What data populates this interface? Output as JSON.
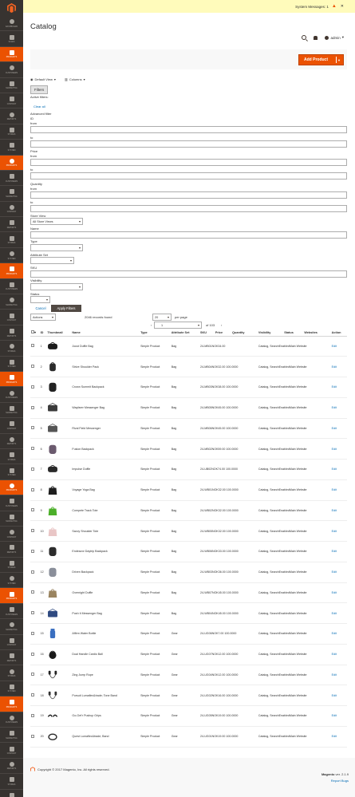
{
  "sidebar": {
    "groups": [
      [
        {
          "label": "Dashboard",
          "icon": "dashboard-icon"
        },
        {
          "label": "Sales",
          "icon": "dollar-icon"
        },
        {
          "label": "Products",
          "icon": "cube-icon",
          "active": true
        },
        {
          "label": "Customers",
          "icon": "user-icon"
        },
        {
          "label": "Marketing",
          "icon": "megaphone-icon"
        },
        {
          "label": "Content",
          "icon": "layout-icon"
        },
        {
          "label": "Reports",
          "icon": "bar-chart-icon"
        },
        {
          "label": "Stores",
          "icon": "store-icon"
        },
        {
          "label": "System",
          "icon": "gear-icon"
        },
        {
          "label": "Products",
          "icon": "cube-icon",
          "active": true
        }
      ],
      [
        {
          "label": "Customers",
          "icon": "user-icon"
        },
        {
          "label": "Marketing",
          "icon": "megaphone-icon"
        },
        {
          "label": "Content",
          "icon": "layout-icon"
        },
        {
          "label": "Reports",
          "icon": "bar-chart-icon"
        },
        {
          "label": "Stores",
          "icon": "store-icon"
        },
        {
          "label": "System",
          "icon": "gear-icon"
        },
        {
          "label": "Products",
          "icon": "cube-icon",
          "active": true
        }
      ]
    ],
    "items": [
      {
        "label": "Dashboard",
        "icon": "dashboard-icon"
      },
      {
        "label": "Sales",
        "icon": "dollar-icon"
      },
      {
        "label": "Products",
        "icon": "cube-icon",
        "active": true
      },
      {
        "label": "Customers",
        "icon": "user-icon"
      },
      {
        "label": "Marketing",
        "icon": "megaphone-icon"
      },
      {
        "label": "Content",
        "icon": "layout-icon"
      },
      {
        "label": "Reports",
        "icon": "bar-chart-icon"
      },
      {
        "label": "Stores",
        "icon": "store-icon"
      },
      {
        "label": "System",
        "icon": "gear-icon"
      },
      {
        "label": "Products",
        "icon": "cube-icon",
        "active": true
      },
      {
        "label": "Customers",
        "icon": "user-icon"
      },
      {
        "label": "Marketing",
        "icon": "megaphone-icon"
      },
      {
        "label": "Content",
        "icon": "layout-icon"
      },
      {
        "label": "Reports",
        "icon": "bar-chart-icon"
      },
      {
        "label": "Stores",
        "icon": "store-icon"
      },
      {
        "label": "System",
        "icon": "gear-icon"
      },
      {
        "label": "Products",
        "icon": "cube-icon",
        "active": true
      },
      {
        "label": "Customers",
        "icon": "user-icon"
      },
      {
        "label": "Marketing",
        "icon": "megaphone-icon"
      },
      {
        "label": "Content",
        "icon": "layout-icon"
      },
      {
        "label": "Reports",
        "icon": "bar-chart-icon"
      },
      {
        "label": "Stores",
        "icon": "store-icon"
      },
      {
        "label": "System",
        "icon": "gear-icon"
      },
      {
        "label": "Products",
        "icon": "cube-icon",
        "active": true
      },
      {
        "label": "Customers",
        "icon": "user-icon"
      },
      {
        "label": "Marketing",
        "icon": "megaphone-icon"
      },
      {
        "label": "Content",
        "icon": "layout-icon"
      },
      {
        "label": "Reports",
        "icon": "bar-chart-icon"
      },
      {
        "label": "Stores",
        "icon": "store-icon"
      },
      {
        "label": "System",
        "icon": "gear-icon"
      },
      {
        "label": "Products",
        "icon": "cube-icon",
        "active": true
      },
      {
        "label": "Customers",
        "icon": "user-icon"
      },
      {
        "label": "Marketing",
        "icon": "megaphone-icon"
      },
      {
        "label": "Content",
        "icon": "layout-icon"
      },
      {
        "label": "Reports",
        "icon": "bar-chart-icon"
      },
      {
        "label": "Stores",
        "icon": "store-icon"
      },
      {
        "label": "System",
        "icon": "gear-icon"
      },
      {
        "label": "Products",
        "icon": "cube-icon",
        "active": true
      },
      {
        "label": "Customers",
        "icon": "user-icon"
      },
      {
        "label": "Marketing",
        "icon": "megaphone-icon"
      },
      {
        "label": "Content",
        "icon": "layout-icon"
      },
      {
        "label": "Reports",
        "icon": "bar-chart-icon"
      },
      {
        "label": "Stores",
        "icon": "store-icon"
      },
      {
        "label": "System",
        "icon": "gear-icon"
      },
      {
        "label": "Products",
        "icon": "cube-icon",
        "active": true
      },
      {
        "label": "Customers",
        "icon": "user-icon"
      },
      {
        "label": "Marketing",
        "icon": "megaphone-icon"
      },
      {
        "label": "Content",
        "icon": "layout-icon"
      },
      {
        "label": "Reports",
        "icon": "bar-chart-icon"
      },
      {
        "label": "Stores",
        "icon": "store-icon"
      },
      {
        "label": "System",
        "icon": "gear-icon"
      },
      {
        "label": "Find Partners & Extensions",
        "icon": "puzzle-icon"
      }
    ]
  },
  "notice": {
    "text": "System Messages: 1"
  },
  "header": {
    "title": "Catalog",
    "user": "admin",
    "add_product": "Add Product"
  },
  "toolbar": {
    "default_view": "Default View",
    "columns": "Columns",
    "filters": "Filters",
    "active_filters": "Active filters:",
    "clear_all": "Clear all"
  },
  "filters": {
    "advanced": "Advanced filter",
    "id": "ID",
    "from": "from",
    "to": "to",
    "price": "Price",
    "quantity": "Quantity",
    "store_view": "Store View",
    "store_view_value": "All Store Views",
    "name": "Name",
    "type": "Type",
    "attribute_set": "Attribute Set",
    "sku": "SKU",
    "visibility": "Visibility",
    "status": "Status",
    "cancel": "Cancel",
    "apply": "Apply Filters"
  },
  "grid": {
    "actions": "Actions",
    "records": "2046 records found",
    "per_page_value": "20",
    "per_page": "per page",
    "page": "1",
    "of_pages": "of 103",
    "columns": [
      "ID",
      "Thumbnail",
      "Name",
      "Type",
      "Attribute Set",
      "SKU",
      "Price",
      "Quantity",
      "Visibility",
      "Status",
      "Websites",
      "Action"
    ],
    "rows": [
      {
        "id": "1",
        "name": "Joust Duffle Bag",
        "type": "Simple Product",
        "set": "Bag",
        "sku": "24-MB01",
        "price": "NOK34.00",
        "qty": "",
        "vis": "Catalog, Search",
        "status": "Enabled",
        "web": "Main Website",
        "action": "Edit",
        "color": "#1b1b1b",
        "shape": "duffle"
      },
      {
        "id": "2",
        "name": "Strive Shoulder Pack",
        "type": "Simple Product",
        "set": "Bag",
        "sku": "24-MB04",
        "price": "NOK32.00",
        "qty": "100.0000",
        "vis": "Catalog, Search",
        "status": "Enabled",
        "web": "Main Website",
        "action": "Edit",
        "color": "#2b2b2b",
        "shape": "pack"
      },
      {
        "id": "3",
        "name": "Crown Summit Backpack",
        "type": "Simple Product",
        "set": "Bag",
        "sku": "24-MB03",
        "price": "NOK38.00",
        "qty": "100.0000",
        "vis": "Catalog, Search",
        "status": "Enabled",
        "web": "Main Website",
        "action": "Edit",
        "color": "#222",
        "shape": "backpack"
      },
      {
        "id": "4",
        "name": "Wayfarer Messenger Bag",
        "type": "Simple Product",
        "set": "Bag",
        "sku": "24-MB05",
        "price": "NOK45.00",
        "qty": "100.0000",
        "vis": "Catalog, Search",
        "status": "Enabled",
        "web": "Main Website",
        "action": "Edit",
        "color": "#3a3a3a",
        "shape": "messenger"
      },
      {
        "id": "5",
        "name": "Rival Field Messenger",
        "type": "Simple Product",
        "set": "Bag",
        "sku": "24-MB06",
        "price": "NOK45.00",
        "qty": "100.0000",
        "vis": "Catalog, Search",
        "status": "Enabled",
        "web": "Main Website",
        "action": "Edit",
        "color": "#555",
        "shape": "messenger"
      },
      {
        "id": "6",
        "name": "Fusion Backpack",
        "type": "Simple Product",
        "set": "Bag",
        "sku": "24-MB02",
        "price": "NOK59.00",
        "qty": "100.0000",
        "vis": "Catalog, Search",
        "status": "Enabled",
        "web": "Main Website",
        "action": "Edit",
        "color": "#6b5a6e",
        "shape": "backpack"
      },
      {
        "id": "7",
        "name": "Impulse Duffle",
        "type": "Simple Product",
        "set": "Bag",
        "sku": "24-UB02",
        "price": "NOK74.00",
        "qty": "100.0000",
        "vis": "Catalog, Search",
        "status": "Enabled",
        "web": "Main Website",
        "action": "Edit",
        "color": "#2a2a2a",
        "shape": "duffle"
      },
      {
        "id": "8",
        "name": "Voyage Yoga Bag",
        "type": "Simple Product",
        "set": "Bag",
        "sku": "24-WB01",
        "price": "NOK32.00",
        "qty": "100.0000",
        "vis": "Catalog, Search",
        "status": "Enabled",
        "web": "Main Website",
        "action": "Edit",
        "color": "#1e1e1e",
        "shape": "tote"
      },
      {
        "id": "9",
        "name": "Compete Track Tote",
        "type": "Simple Product",
        "set": "Bag",
        "sku": "24-WB02",
        "price": "NOK32.00",
        "qty": "100.0000",
        "vis": "Catalog, Search",
        "status": "Enabled",
        "web": "Main Website",
        "action": "Edit",
        "color": "#4caf2a",
        "shape": "tote"
      },
      {
        "id": "10",
        "name": "Savvy Shoulder Tote",
        "type": "Simple Product",
        "set": "Bag",
        "sku": "24-WB05",
        "price": "NOK32.00",
        "qty": "100.0000",
        "vis": "Catalog, Search",
        "status": "Enabled",
        "web": "Main Website",
        "action": "Edit",
        "color": "#e9c6c6",
        "shape": "tote"
      },
      {
        "id": "11",
        "name": "Endeavor Daytrip Backpack",
        "type": "Simple Product",
        "set": "Bag",
        "sku": "24-WB06",
        "price": "NOK33.00",
        "qty": "100.0000",
        "vis": "Catalog, Search",
        "status": "Enabled",
        "web": "Main Website",
        "action": "Edit",
        "color": "#2c2c2c",
        "shape": "backpack"
      },
      {
        "id": "12",
        "name": "Driven Backpack",
        "type": "Simple Product",
        "set": "Bag",
        "sku": "24-WB03",
        "price": "NOK36.00",
        "qty": "100.0000",
        "vis": "Catalog, Search",
        "status": "Enabled",
        "web": "Main Website",
        "action": "Edit",
        "color": "#8a8f9a",
        "shape": "backpack"
      },
      {
        "id": "13",
        "name": "Overnight Duffle",
        "type": "Simple Product",
        "set": "Bag",
        "sku": "24-WB07",
        "price": "NOK45.00",
        "qty": "100.0000",
        "vis": "Catalog, Search",
        "status": "Enabled",
        "web": "Main Website",
        "action": "Edit",
        "color": "#9a8460",
        "shape": "tote"
      },
      {
        "id": "14",
        "name": "Push It Messenger Bag",
        "type": "Simple Product",
        "set": "Bag",
        "sku": "24-WB04",
        "price": "NOK45.00",
        "qty": "100.0000",
        "vis": "Catalog, Search",
        "status": "Enabled",
        "web": "Main Website",
        "action": "Edit",
        "color": "#2f4a80",
        "shape": "messenger"
      },
      {
        "id": "15",
        "name": "Affirm Water Bottle",
        "type": "Simple Product",
        "set": "Gear",
        "sku": "24-UG06",
        "price": "NOK7.00",
        "qty": "100.0000",
        "vis": "Catalog, Search",
        "status": "Enabled",
        "web": "Main Website",
        "action": "Edit",
        "color": "#3a6fc0",
        "shape": "bottle"
      },
      {
        "id": "16",
        "name": "Dual Handle Cardio Ball",
        "type": "Simple Product",
        "set": "Gear",
        "sku": "24-UG07",
        "price": "NOK12.00",
        "qty": "100.0000",
        "vis": "Catalog, Search",
        "status": "Enabled",
        "web": "Main Website",
        "action": "Edit",
        "color": "#1a1a1a",
        "shape": "ball"
      },
      {
        "id": "17",
        "name": "Zing Jump Rope",
        "type": "Simple Product",
        "set": "Gear",
        "sku": "24-UG04",
        "price": "NOK12.00",
        "qty": "100.0000",
        "vis": "Catalog, Search",
        "status": "Enabled",
        "web": "Main Website",
        "action": "Edit",
        "color": "#222",
        "shape": "rope"
      },
      {
        "id": "18",
        "name": "Pursuit Lumaflex&trade; Tone Band",
        "type": "Simple Product",
        "set": "Gear",
        "sku": "24-UG02",
        "price": "NOK16.00",
        "qty": "100.0000",
        "vis": "Catalog, Search",
        "status": "Enabled",
        "web": "Main Website",
        "action": "Edit",
        "color": "#333",
        "shape": "rope"
      },
      {
        "id": "19",
        "name": "Go-Get'r Pushup Grips",
        "type": "Simple Product",
        "set": "Gear",
        "sku": "24-UG05",
        "price": "NOK19.00",
        "qty": "100.0000",
        "vis": "Catalog, Search",
        "status": "Enabled",
        "web": "Main Website",
        "action": "Edit",
        "color": "#1a1a1a",
        "shape": "grips"
      },
      {
        "id": "20",
        "name": "Quest Lumaflex&trade; Band",
        "type": "Simple Product",
        "set": "Gear",
        "sku": "24-UG01",
        "price": "NOK19.00",
        "qty": "100.0000",
        "vis": "Catalog, Search",
        "status": "Enabled",
        "web": "Main Website",
        "action": "Edit",
        "color": "#2a2a2a",
        "shape": "band"
      }
    ]
  },
  "footer": {
    "copyright": "Copyright © 2017 Magento, Inc. All rights reserved.",
    "version_brand": "Magento",
    "version": "ver. 2.1.9",
    "report_bugs": "Report Bugs"
  },
  "colors": {
    "accent": "#eb5202",
    "sidebar": "#373330",
    "link": "#006bb4",
    "notice_bg": "#fffbbb"
  }
}
